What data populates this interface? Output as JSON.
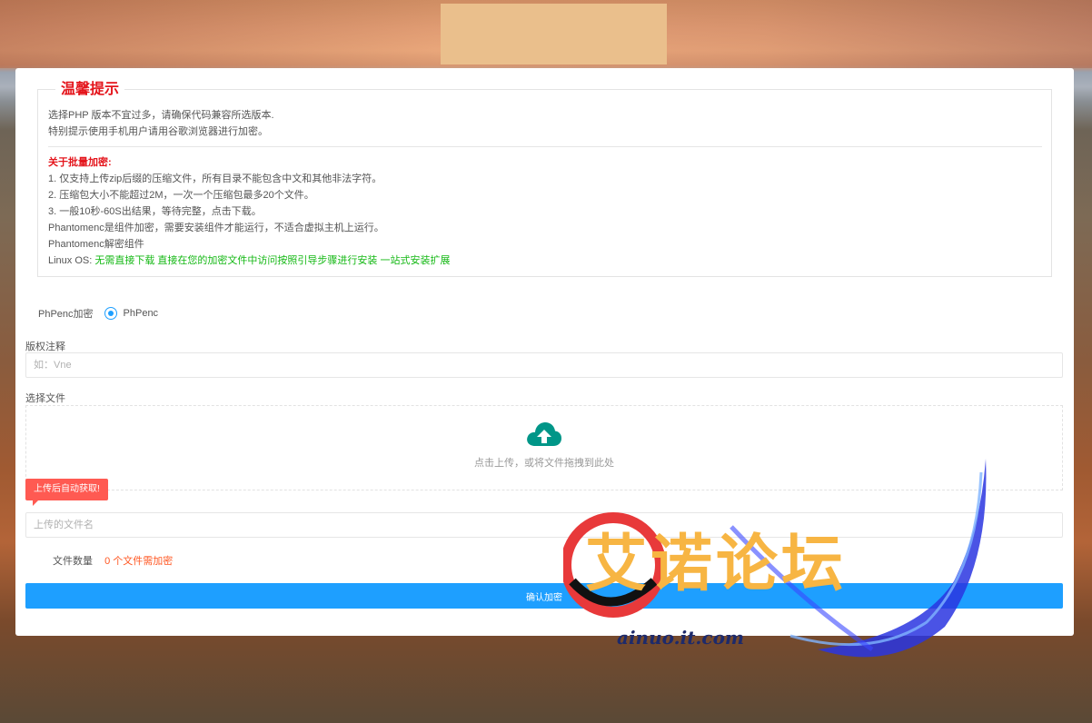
{
  "notice": {
    "title": "温馨提示",
    "intro": [
      "选择PHP 版本不宜过多，请确保代码兼容所选版本.",
      "特别提示使用手机用户请用谷歌浏览器进行加密。"
    ],
    "batch_title": "关于批量加密:",
    "batch_items": [
      "1. 仅支持上传zip后缀的压缩文件，所有目录不能包含中文和其他非法字符。",
      "2. 压缩包大小不能超过2M，一次一个压缩包最多20个文件。",
      "3. 一般10秒-60S出结果，等待完整，点击下载。",
      "Phantomenc是组件加密，需要安装组件才能运行，不适合虚拟主机上运行。",
      "Phantomenc解密组件"
    ],
    "linux_label": "Linux OS: ",
    "linux_text": "无需直接下载 直接在您的加密文件中访问按照引导步骤进行安装 一站式安装扩展"
  },
  "encrypt_mode": {
    "label": "PhPenc加密",
    "option": "PhPenc"
  },
  "copyright": {
    "label": "版权注释",
    "placeholder": "如：Vne"
  },
  "upload": {
    "label": "选择文件",
    "text": "点击上传，或将文件拖拽到此处",
    "icon": "cloud-upload-icon",
    "color": "#009688"
  },
  "tip": "上传后自动获取!",
  "filename": {
    "placeholder": "上传的文件名"
  },
  "file_count": {
    "label": "文件数量",
    "value": "0 个文件需加密"
  },
  "submit_label": "确认加密",
  "watermark": {
    "cn": "艾诺论坛",
    "en": "ainuo.it.com"
  },
  "colors": {
    "accent": "#1e9fff",
    "warning": "#e4141b",
    "success": "#14b814",
    "tip": "#ff5a52",
    "count": "#ff5722"
  }
}
